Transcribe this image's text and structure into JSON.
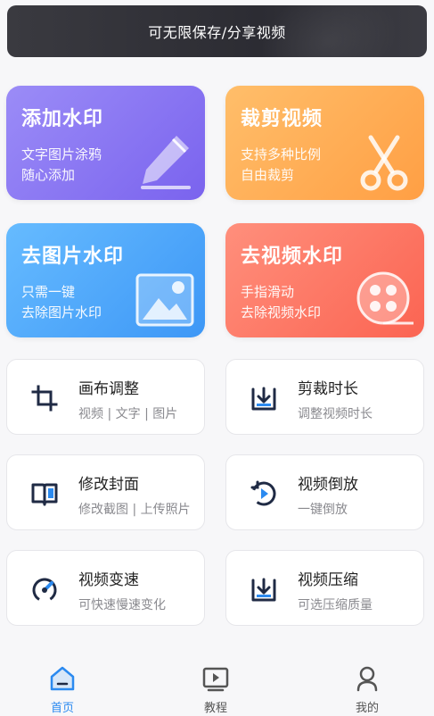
{
  "banner": {
    "text": "可无限保存/分享视频"
  },
  "feature_cards": [
    {
      "title": "添加水印",
      "line1": "文字图片涂鸦",
      "line2": "随心添加",
      "icon": "pencil-icon"
    },
    {
      "title": "裁剪视频",
      "line1": "支持多种比例",
      "line2": "自由裁剪",
      "icon": "scissors-icon"
    },
    {
      "title": "去图片水印",
      "line1": "只需一键",
      "line2": "去除图片水印",
      "icon": "image-icon"
    },
    {
      "title": "去视频水印",
      "line1": "手指滑动",
      "line2": "去除视频水印",
      "icon": "film-reel-icon"
    }
  ],
  "tools": [
    {
      "name": "画布调整",
      "desc": "视频 | 文字 | 图片",
      "icon": "crop-icon"
    },
    {
      "name": "剪裁时长",
      "desc": "调整视频时长",
      "icon": "trim-download-icon"
    },
    {
      "name": "修改封面",
      "desc": "修改截图 | 上传照片",
      "icon": "book-icon"
    },
    {
      "name": "视频倒放",
      "desc": "一键倒放",
      "icon": "reverse-play-icon"
    },
    {
      "name": "视频变速",
      "desc": "可快速慢速变化",
      "icon": "speedometer-icon"
    },
    {
      "name": "视频压缩",
      "desc": "可选压缩质量",
      "icon": "compress-icon"
    }
  ],
  "tabbar": [
    {
      "label": "首页",
      "icon": "home-icon",
      "active": true
    },
    {
      "label": "教程",
      "icon": "play-square-icon",
      "active": false
    },
    {
      "label": "我的",
      "icon": "user-icon",
      "active": false
    }
  ],
  "colors": {
    "card_purple": "#7a63ee",
    "card_orange": "#ff9f44",
    "card_blue": "#3d97f6",
    "card_red": "#fb6452",
    "accent_blue": "#2b8af0",
    "icon_dark": "#1f2a44"
  }
}
